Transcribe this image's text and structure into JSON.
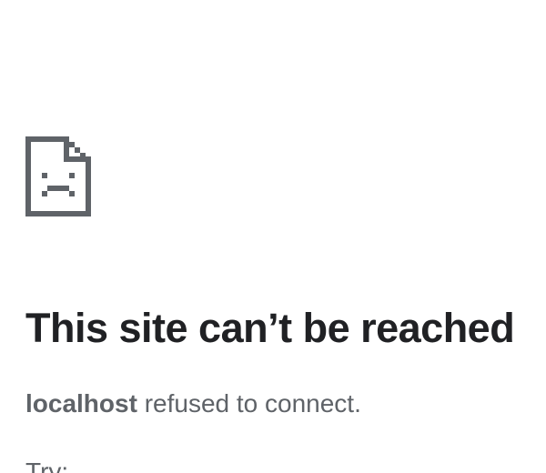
{
  "error": {
    "icon": "sad-page-icon",
    "heading": "This site can’t be reached",
    "host": "localhost",
    "detail_suffix": " refused to connect.",
    "suggestions_label": "Try:"
  },
  "colors": {
    "heading": "#202124",
    "body_text": "#5f6368",
    "icon": "#5f6368",
    "background": "#ffffff"
  }
}
